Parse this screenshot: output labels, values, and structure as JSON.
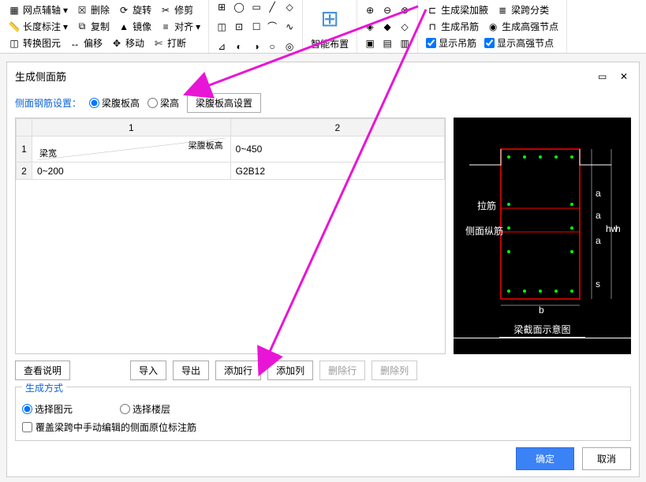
{
  "ribbon": {
    "col1": {
      "r1": "网点辅轴",
      "r2": "长度标注",
      "r3": "转换图元"
    },
    "col2": {
      "r1": "删除",
      "r2": "复制",
      "r3": "偏移"
    },
    "col3": {
      "r1": "旋转",
      "r2": "镜像",
      "r3": "移动"
    },
    "col4": {
      "r1": "修剪",
      "r2": "对齐",
      "r3": "打断"
    },
    "smart": "智能布置",
    "gen": {
      "a": "生成梁加腋",
      "b": "生成吊筋",
      "c": "显示吊筋",
      "d": "梁跨分类",
      "e": "生成高强节点",
      "f": "显示高强节点"
    }
  },
  "dialog": {
    "title": "生成侧面筋",
    "setting_label": "侧面钢筋设置：",
    "radio1": "梁腹板高",
    "radio2": "梁高",
    "config_btn": "梁腹板高设置",
    "table": {
      "col1": "1",
      "col2": "2",
      "diag_top": "梁腹板高",
      "diag_left": "梁宽",
      "rows": [
        {
          "n": "1",
          "c1_val": "",
          "c2": "0~450"
        },
        {
          "n": "2",
          "c1_val": "0~200",
          "c2": "G2B12"
        }
      ]
    },
    "preview_caption": "梁截面示意图",
    "preview_label1": "拉筋",
    "preview_label2": "侧面纵筋",
    "btns": {
      "view_desc": "查看说明",
      "import": "导入",
      "export": "导出",
      "add_row": "添加行",
      "add_col": "添加列",
      "del_row": "删除行",
      "del_col": "删除列"
    },
    "gen_mode": {
      "legend": "生成方式",
      "radio1": "选择图元",
      "radio2": "选择楼层",
      "chk": "覆盖梁跨中手动编辑的侧面原位标注筋"
    },
    "ok": "确定",
    "cancel": "取消"
  }
}
